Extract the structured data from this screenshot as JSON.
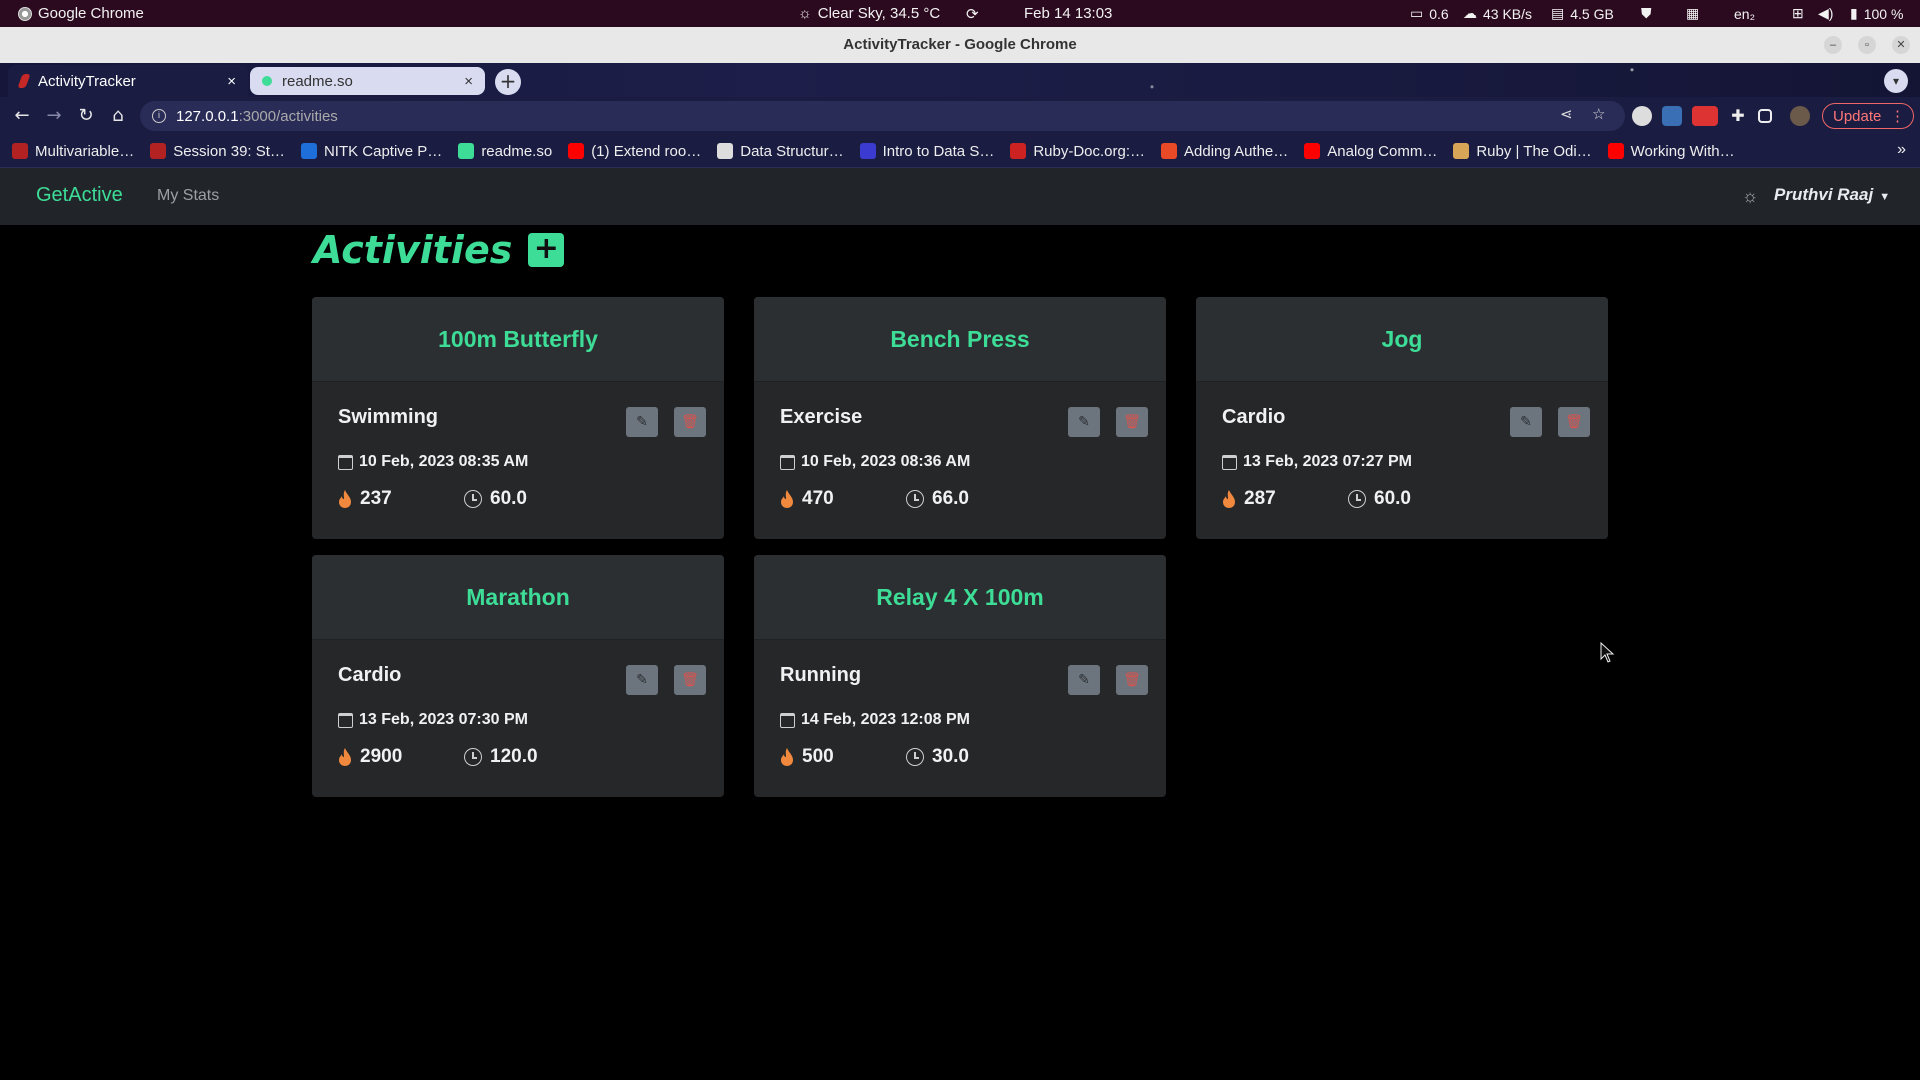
{
  "os": {
    "app_name": "Google Chrome",
    "weather": "Clear Sky, 34.5 °C",
    "datetime": "Feb 14  13:03",
    "load": "0.6",
    "net": "43 KB/s",
    "mem": "4.5 GB",
    "lang": "en₂",
    "battery": "100 %"
  },
  "window": {
    "title": "ActivityTracker - Google Chrome"
  },
  "tabs": [
    {
      "label": "ActivityTracker",
      "close": "×"
    },
    {
      "label": "readme.so",
      "close": "×"
    }
  ],
  "toolbar": {
    "url_host": "127.0.0.1",
    "url_path": ":3000/activities",
    "update_label": "Update"
  },
  "bookmarks": [
    {
      "label": "Multivariable…",
      "color": "#b22222"
    },
    {
      "label": "Session 39: St…",
      "color": "#b22222"
    },
    {
      "label": "NITK Captive P…",
      "color": "#1e6fd9"
    },
    {
      "label": "readme.so",
      "color": "#3ddc97"
    },
    {
      "label": "(1) Extend roo…",
      "color": "#ff0000"
    },
    {
      "label": "Data Structur…",
      "color": "#dddddd"
    },
    {
      "label": "Intro to Data S…",
      "color": "#3b3bd1"
    },
    {
      "label": "Ruby-Doc.org:…",
      "color": "#cc2222"
    },
    {
      "label": "Adding Authe…",
      "color": "#e84a27"
    },
    {
      "label": "Analog Comm…",
      "color": "#ff0000"
    },
    {
      "label": "Ruby | The Odi…",
      "color": "#d8a657"
    },
    {
      "label": "Working With…",
      "color": "#ff0000"
    }
  ],
  "app": {
    "brand": "GetActive",
    "nav_stats": "My Stats",
    "user": "Pruthvi Raaj",
    "page_title": "Activities",
    "add_label": "+",
    "accent": "#3ddc97"
  },
  "activities": [
    {
      "name": "100m Butterfly",
      "category": "Swimming",
      "date": "10 Feb, 2023 08:35 AM",
      "calories": "237",
      "duration": "60.0"
    },
    {
      "name": "Bench Press",
      "category": "Exercise",
      "date": "10 Feb, 2023 08:36 AM",
      "calories": "470",
      "duration": "66.0"
    },
    {
      "name": "Jog",
      "category": "Cardio",
      "date": "13 Feb, 2023 07:27 PM",
      "calories": "287",
      "duration": "60.0"
    },
    {
      "name": "Marathon",
      "category": "Cardio",
      "date": "13 Feb, 2023 07:30 PM",
      "calories": "2900",
      "duration": "120.0"
    },
    {
      "name": "Relay 4 X 100m",
      "category": "Running",
      "date": "14 Feb, 2023 12:08 PM",
      "calories": "500",
      "duration": "30.0"
    }
  ]
}
